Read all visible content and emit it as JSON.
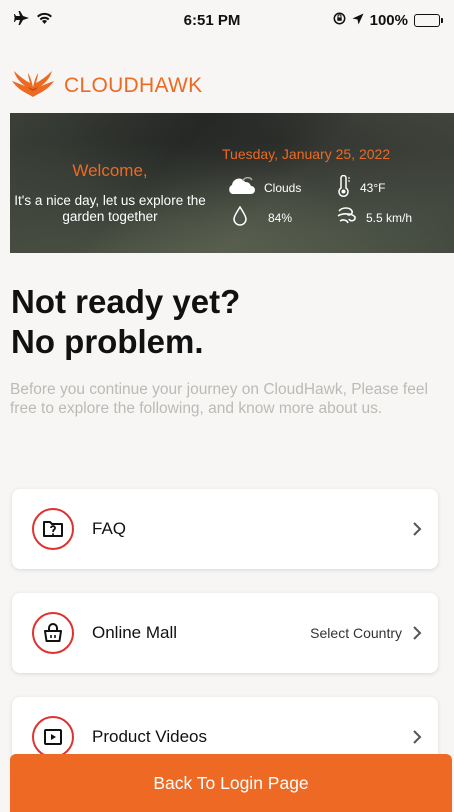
{
  "status_bar": {
    "time": "6:51 PM",
    "battery": "100%"
  },
  "brand": {
    "name": "CLOUDHAWK",
    "color": "#ec6a22"
  },
  "weather": {
    "welcome": "Welcome,",
    "message": "It's a nice day, let us explore the garden together",
    "date": "Tuesday, January 25, 2022",
    "condition": "Clouds",
    "temperature": "43°F",
    "humidity": "84%",
    "wind": "5.5 km/h"
  },
  "headline": {
    "line1": "Not ready yet?",
    "line2": "No problem."
  },
  "intro": "Before you continue your journey on CloudHawk, Please feel free to explore the following, and know more about us.",
  "cards": [
    {
      "label": "FAQ",
      "icon": "faq-folder-icon"
    },
    {
      "label": "Online Mall",
      "extra": "Select Country",
      "icon": "shopping-basket-icon"
    },
    {
      "label": "Product Videos",
      "icon": "video-play-icon"
    }
  ],
  "bottom_button": {
    "label": "Back To Login Page",
    "color": "#ee6a24"
  },
  "accent_red": "#e0322f"
}
